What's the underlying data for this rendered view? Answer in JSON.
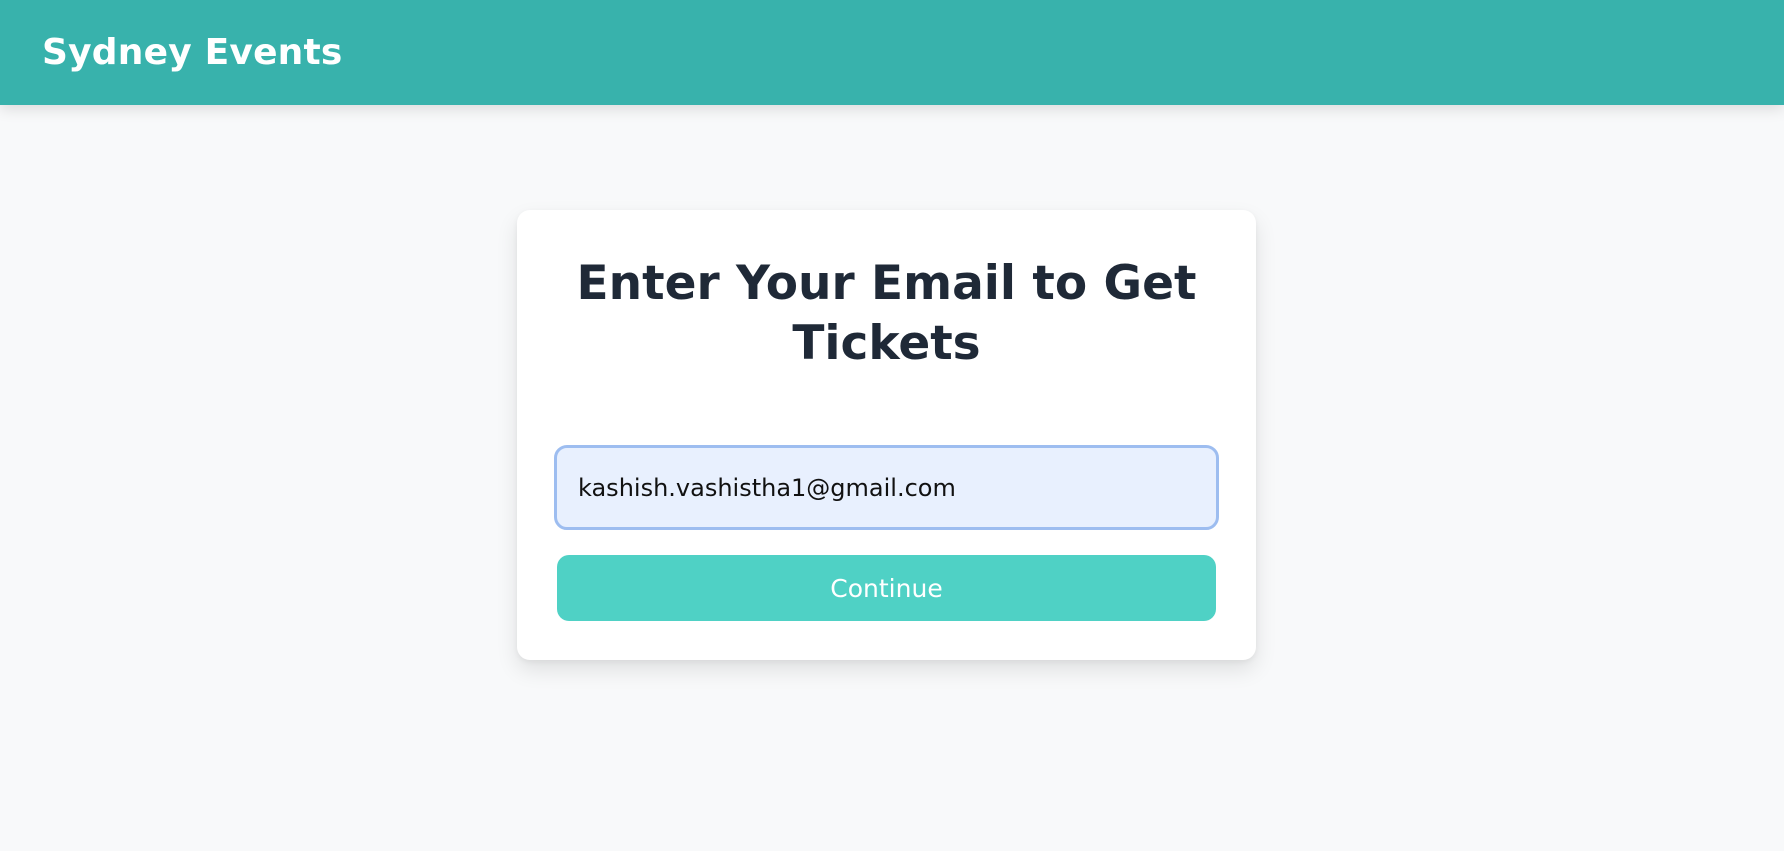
{
  "header": {
    "brand": "Sydney Events",
    "background_color": "#38b2ac"
  },
  "card": {
    "title": "Enter Your Email to Get Tickets",
    "email_input": {
      "value": "kashish.vashistha1@gmail.com",
      "placeholder": ""
    },
    "continue_label": "Continue",
    "button_color": "#4fd1c5"
  }
}
